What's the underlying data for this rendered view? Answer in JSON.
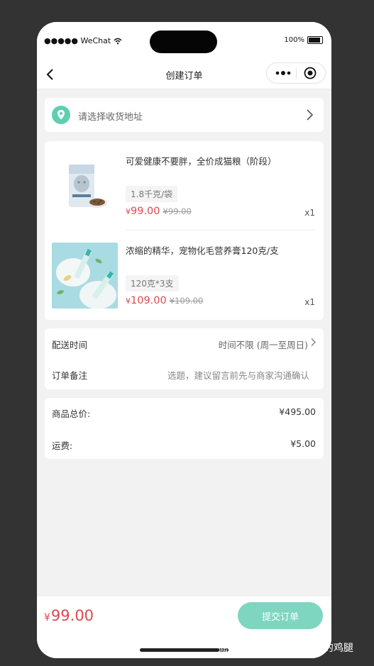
{
  "status_bar": {
    "carrier": "●●●●● WeChat",
    "battery_text": "100%"
  },
  "navbar": {
    "title": "创建订单"
  },
  "address": {
    "placeholder": "请选择收货地址"
  },
  "goods": [
    {
      "name": "可爱健康不要胖，全价成猫粮（阶段）",
      "spec": "1.8千克/袋",
      "currency": "¥",
      "price": "99.00",
      "original_price": "¥99.00",
      "qty": "x1",
      "image_icon": "cat-food-bag-image"
    },
    {
      "name": "浓缩的精华，宠物化毛营养膏120克/支",
      "spec": "120克*3支",
      "currency": "¥",
      "price": "109.00",
      "original_price": "¥109.00",
      "qty": "x1",
      "image_icon": "pet-paste-tubes-image"
    }
  ],
  "delivery": {
    "time_label": "配送时间",
    "time_value": "时间不限 (周一至周日)",
    "note_label": "订单备注",
    "note_placeholder": "选题，建议留言前先与商家沟通确认"
  },
  "summary": {
    "goods_total_label": "商品总价:",
    "goods_total_value": "¥495.00",
    "shipping_label": "运费:",
    "shipping_value": "¥5.00"
  },
  "bottom": {
    "currency": "¥",
    "total": "99.00",
    "submit_label": "提交订单"
  },
  "watermark": "掘金技术社区 @ 爱泡脚的鸡腿",
  "colors": {
    "accent": "#7fd6c0",
    "price": "#e0474f",
    "background": "#f2f2f2"
  }
}
